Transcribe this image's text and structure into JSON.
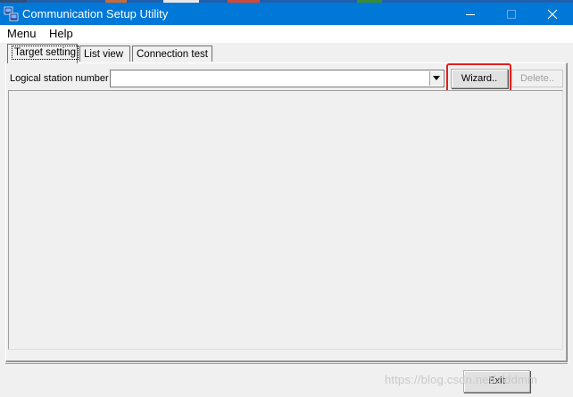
{
  "window": {
    "title": "Communication Setup Utility",
    "accent_color": "#0078d7",
    "icons": [
      "app-icon",
      "minimize-icon",
      "maximize-icon",
      "close-icon"
    ]
  },
  "menu": {
    "items": [
      {
        "label": "Menu"
      },
      {
        "label": "Help"
      }
    ]
  },
  "tabs": [
    {
      "label": "Target setting",
      "active": true
    },
    {
      "label": "List view",
      "active": false
    },
    {
      "label": "Connection test",
      "active": false
    }
  ],
  "target_setting": {
    "logical_station_label": "Logical station number",
    "logical_station_value": "",
    "wizard_label": "Wizard..",
    "delete_label": "Delete..",
    "highlight_color": "#e0201c"
  },
  "footer": {
    "exit_label": "Exit"
  },
  "watermark": "https://blog.csdn.net/zlddmm"
}
